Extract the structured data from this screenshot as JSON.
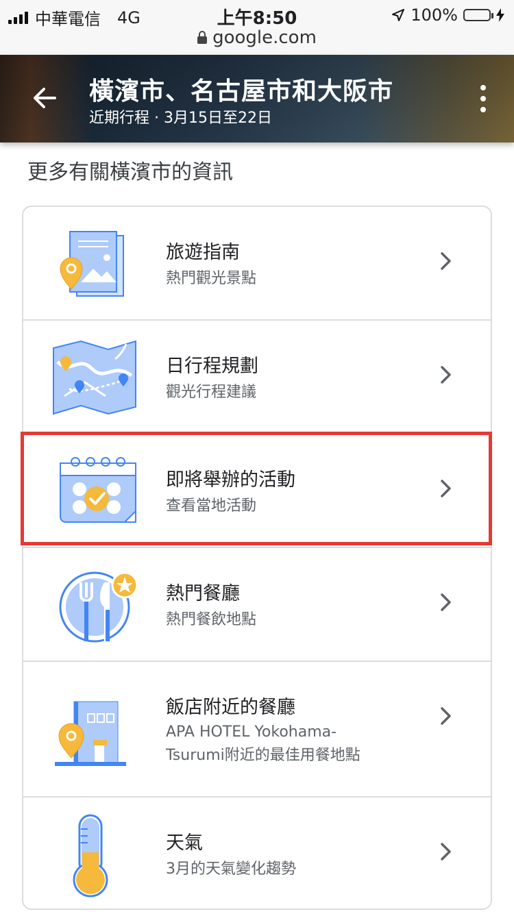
{
  "status_bar": {
    "carrier": "中華電信",
    "network": "4G",
    "time": "上午8:50",
    "battery": "100%",
    "battery_level": 1.0,
    "url": "google.com"
  },
  "header": {
    "title": "橫濱市、名古屋市和大阪市",
    "subtitle": "近期行程 · 3月15日至22日",
    "back_icon": "arrow-left-icon",
    "menu_icon": "more-vert-icon"
  },
  "section": {
    "title": "更多有關橫濱市的資訊"
  },
  "items": [
    {
      "title": "旅遊指南",
      "subtitle": "熱門觀光景點",
      "icon": "travel-guide-icon"
    },
    {
      "title": "日行程規劃",
      "subtitle": "觀光行程建議",
      "icon": "map-icon"
    },
    {
      "title": "即將舉辦的活動",
      "subtitle": "查看當地活動",
      "icon": "calendar-icon"
    },
    {
      "title": "熱門餐廳",
      "subtitle": "熱門餐飲地點",
      "icon": "restaurant-icon"
    },
    {
      "title": "飯店附近的餐廳",
      "subtitle_line1": "APA HOTEL Yokohama-",
      "subtitle_line2": "Tsurumi附近的最佳用餐地點",
      "icon": "hotel-icon"
    },
    {
      "title": "天氣",
      "subtitle": "3月的天氣變化趨勢",
      "icon": "thermometer-icon"
    }
  ],
  "colors": {
    "accent_blue": "#4285f4",
    "light_blue": "#aecbfa",
    "accent_yellow": "#f6b93b",
    "highlight_red": "#e53935"
  }
}
